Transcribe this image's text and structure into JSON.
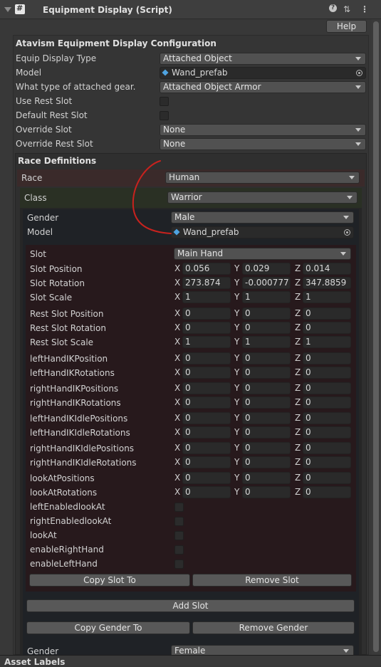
{
  "header": {
    "title": "Equipment Display (Script)",
    "help_icon": "?",
    "settings_icon": "⇅",
    "menu_icon": "⋮"
  },
  "help_button": "Help",
  "config_title": "Atavism Equipment Display Configuration",
  "fields": {
    "equip_display_type": {
      "label": "Equip Display Type",
      "value": "Attached Object"
    },
    "model": {
      "label": "Model",
      "value": "Wand_prefab"
    },
    "attached_gear": {
      "label": "What type of attached gear.",
      "value": "Attached Object Armor"
    },
    "use_rest_slot": {
      "label": "Use Rest Slot"
    },
    "default_rest_slot": {
      "label": "Default Rest Slot"
    },
    "override_slot": {
      "label": "Override Slot",
      "value": "None"
    },
    "override_rest_slot": {
      "label": "Override Rest Slot",
      "value": "None"
    }
  },
  "race_definitions": {
    "title": "Race Definitions",
    "race": {
      "label": "Race",
      "value": "Human"
    },
    "class": {
      "label": "Class",
      "value": "Warrior"
    },
    "gender": {
      "label": "Gender",
      "value": "Male"
    },
    "model": {
      "label": "Model",
      "value": "Wand_prefab"
    },
    "slot": {
      "label": "Slot",
      "value": "Main Hand"
    },
    "axis": {
      "x": "X",
      "y": "Y",
      "z": "Z"
    },
    "vectors": [
      {
        "label": "Slot Position",
        "x": "0.056",
        "y": "0.029",
        "z": "0.014"
      },
      {
        "label": "Slot Rotation",
        "x": "273.874",
        "y": "-0.000777",
        "z": "347.8859"
      },
      {
        "label": "Slot Scale",
        "x": "1",
        "y": "1",
        "z": "1"
      },
      {
        "label": "Rest Slot Position",
        "x": "0",
        "y": "0",
        "z": "0"
      },
      {
        "label": "Rest Slot Rotation",
        "x": "0",
        "y": "0",
        "z": "0"
      },
      {
        "label": "Rest Slot Scale",
        "x": "1",
        "y": "1",
        "z": "1"
      },
      {
        "label": "leftHandIKPosition",
        "x": "0",
        "y": "0",
        "z": "0"
      },
      {
        "label": "leftHandIKRotations",
        "x": "0",
        "y": "0",
        "z": "0"
      },
      {
        "label": "rightHandIKPositions",
        "x": "0",
        "y": "0",
        "z": "0"
      },
      {
        "label": "rightHandIKRotations",
        "x": "0",
        "y": "0",
        "z": "0"
      },
      {
        "label": "leftHandIKIdlePositions",
        "x": "0",
        "y": "0",
        "z": "0"
      },
      {
        "label": "leftHandIKIdleRotations",
        "x": "0",
        "y": "0",
        "z": "0"
      },
      {
        "label": "rightHandIKIdlePositions",
        "x": "0",
        "y": "0",
        "z": "0"
      },
      {
        "label": "rightHandIKIdleRotations",
        "x": "0",
        "y": "0",
        "z": "0"
      },
      {
        "label": "lookAtPositions",
        "x": "0",
        "y": "0",
        "z": "0"
      },
      {
        "label": "lookAtRotations",
        "x": "0",
        "y": "0",
        "z": "0"
      }
    ],
    "toggles": [
      "leftEnabledlookAt",
      "rightEnabledlookAt",
      "lookAt",
      "enableRightHand",
      "enableLeftHand"
    ],
    "buttons": {
      "copy_slot": "Copy Slot To",
      "remove_slot": "Remove Slot",
      "add_slot": "Add Slot",
      "copy_gender": "Copy Gender To",
      "remove_gender": "Remove Gender"
    },
    "gender2": {
      "label": "Gender",
      "value": "Female"
    }
  },
  "footer": {
    "label": "Asset Labels"
  },
  "colors": {
    "annotation": "#c8221e"
  }
}
